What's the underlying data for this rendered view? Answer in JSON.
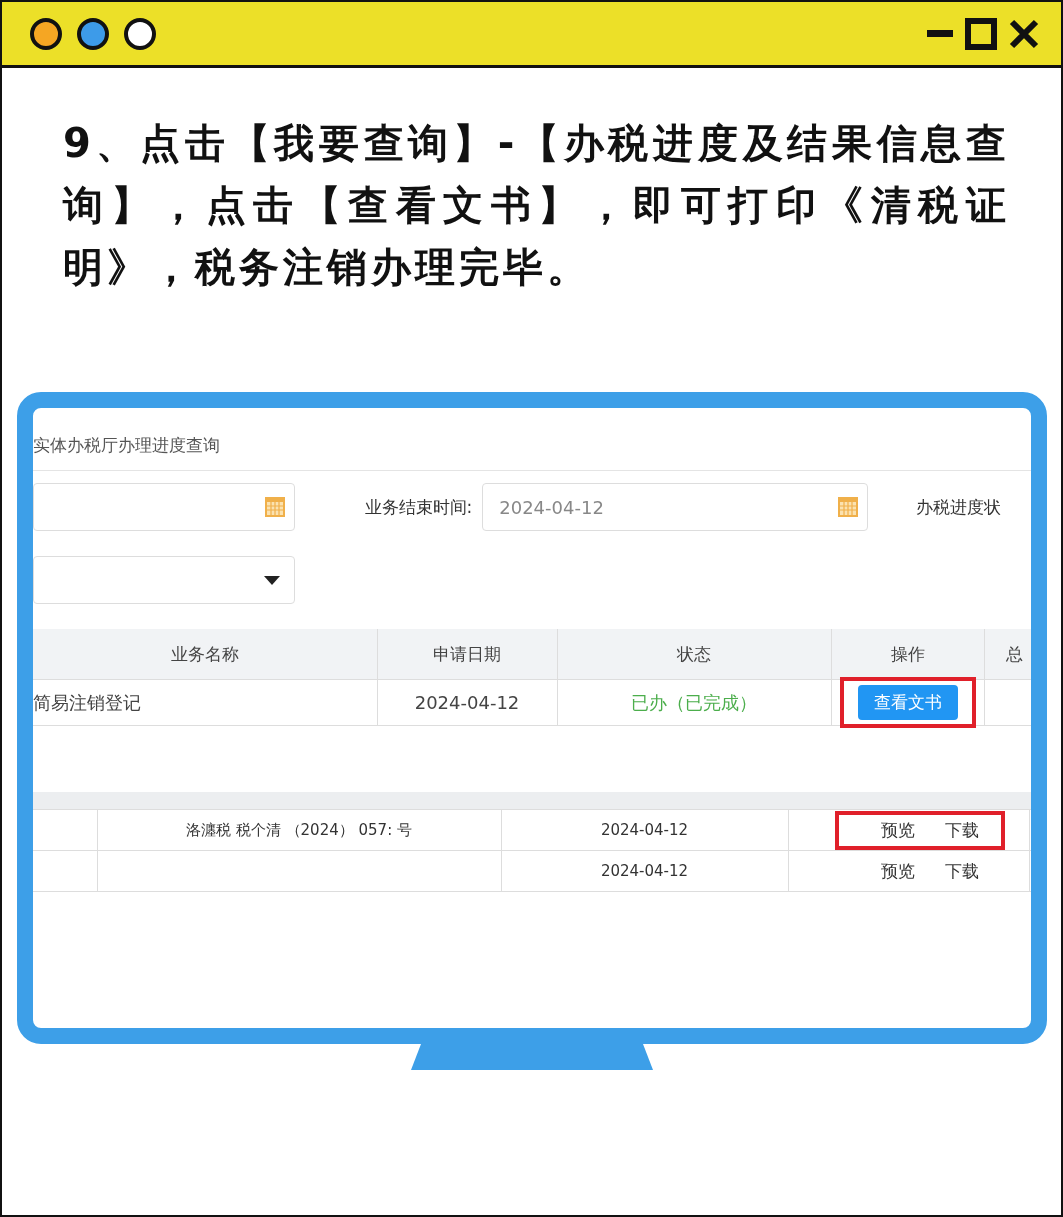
{
  "window": {
    "dots": [
      {
        "color": "#f5a623"
      },
      {
        "color": "#3d9be9"
      },
      {
        "color": "#ffffff"
      }
    ]
  },
  "instruction": "9、点击【我要查询】-【办税进度及结果信息查询】，点击【查看文书】，即可打印《清税证明》，税务注销办理完毕。",
  "screen": {
    "page_title": "实体办税厅办理进度查询",
    "filters": [
      {
        "kind": "short_date"
      },
      {
        "kind": "date",
        "label": "业务结束时间:",
        "value": "2024-04-12"
      },
      {
        "kind": "label",
        "label": "办税进度状"
      }
    ],
    "dropdown": {
      "kind": "select"
    },
    "table": {
      "columns": [
        "业务名称",
        "申请日期",
        "状态",
        "操作",
        "总"
      ],
      "rows": [
        {
          "name": "简易注销登记",
          "date": "2024-04-12",
          "status": "已办（已完成）",
          "action": "查看文书",
          "highlighted": true
        }
      ]
    },
    "documents": {
      "rows": [
        {
          "title": "洛瀍税 税个清 （2024） 057: 号",
          "date": "2024-04-12",
          "actions": [
            "预览",
            "下载"
          ],
          "highlighted": true
        },
        {
          "date": "2024-04-12",
          "actions": [
            "预览",
            "下载"
          ],
          "highlighted": false
        }
      ]
    }
  }
}
